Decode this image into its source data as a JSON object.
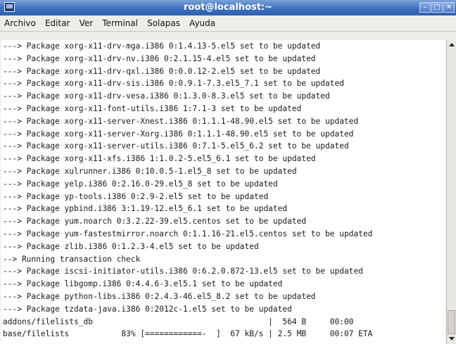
{
  "window": {
    "title": "root@localhost:~",
    "minimize_glyph": "–",
    "maximize_glyph": "□",
    "close_glyph": "✕"
  },
  "menu": [
    {
      "label": "Archivo"
    },
    {
      "label": "Editar"
    },
    {
      "label": "Ver"
    },
    {
      "label": "Terminal"
    },
    {
      "label": "Solapas"
    },
    {
      "label": "Ayuda"
    }
  ],
  "terminal": {
    "lines": [
      "---> Package xorg-x11-drv-mga.i386 0:1.4.13-5.el5 set to be updated",
      "---> Package xorg-x11-drv-nv.i386 0:2.1.15-4.el5 set to be updated",
      "---> Package xorg-x11-drv-qxl.i386 0:0.0.12-2.el5 set to be updated",
      "---> Package xorg-x11-drv-sis.i386 0:0.9.1-7.3.el5_7.1 set to be updated",
      "---> Package xorg-x11-drv-vesa.i386 0:1.3.0-8.3.el5 set to be updated",
      "---> Package xorg-x11-font-utils.i386 1:7.1-3 set to be updated",
      "---> Package xorg-x11-server-Xnest.i386 0:1.1.1-48.90.el5 set to be updated",
      "---> Package xorg-x11-server-Xorg.i386 0:1.1.1-48.90.el5 set to be updated",
      "---> Package xorg-x11-server-utils.i386 0:7.1-5.el5_6.2 set to be updated",
      "---> Package xorg-x11-xfs.i386 1:1.0.2-5.el5_6.1 set to be updated",
      "---> Package xulrunner.i386 0:10.0.5-1.el5_8 set to be updated",
      "---> Package yelp.i386 0:2.16.0-29.el5_8 set to be updated",
      "---> Package yp-tools.i386 0:2.9-2.el5 set to be updated",
      "---> Package ypbind.i386 3:1.19-12.el5_6.1 set to be updated",
      "---> Package yum.noarch 0:3.2.22-39.el5.centos set to be updated",
      "---> Package yum-fastestmirror.noarch 0:1.1.16-21.el5.centos set to be updated",
      "---> Package zlib.i386 0:1.2.3-4.el5 set to be updated",
      "--> Running transaction check",
      "---> Package iscsi-initiator-utils.i386 0:6.2.0.872-13.el5 set to be updated",
      "---> Package libgomp.i386 0:4.4.6-3.el5.1 set to be updated",
      "---> Package python-libs.i386 0:2.4.3-46.el5_8.2 set to be updated",
      "---> Package tzdata-java.i386 0:2012c-1.el5 set to be updated",
      "addons/filelists_db                                     |  564 B     00:00",
      "base/filelists           83% [============-  ]  67 kB/s | 2.5 MB     00:07 ETA"
    ]
  }
}
